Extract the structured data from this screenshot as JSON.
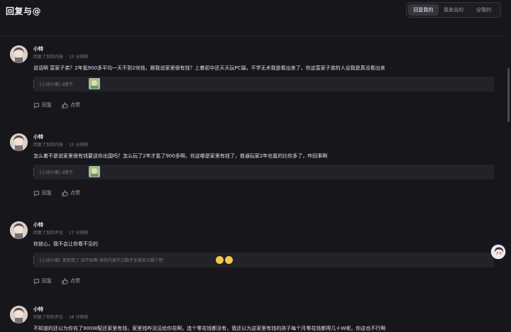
{
  "page": {
    "title": "回复与@"
  },
  "tabs": [
    {
      "label": "回复我的",
      "active": true
    },
    {
      "label": "我发出的",
      "active": false
    },
    {
      "label": "@我的",
      "active": false
    }
  ],
  "actions": {
    "reply_label": "回复",
    "like_label": "点赞"
  },
  "items": [
    {
      "username": "小特",
      "meta_action": "回复了你的内容",
      "time": "13 分钟前",
      "text": "说话啊 富家子弟？2年氪900多平均一天不到2块钱，跟我说家里很有钱？上着初中还天天玩PC端，不学无术我是看出来了，你这富家子弟的人设我是真没看出来",
      "quote_tag": "[心动小镇]",
      "quote_text": "d搓子",
      "quote_extras": "sticker"
    },
    {
      "username": "小特",
      "meta_action": "回复了你的内容",
      "time": "15 分钟前",
      "text": "怎么着不是说家里很有钱要送你出国吗？怎么玩了2年才氪了900多啊，你这哪是家里有钱了，普通玩家2年也氪的比你多了，咋回事啊",
      "quote_tag": "[心动小镇]",
      "quote_text": "d搓子",
      "quote_extras": "sticker"
    },
    {
      "username": "小特",
      "meta_action": "回复了你的评论",
      "time": "17 分钟前",
      "text": "你放心，我不会让你看不见的",
      "quote_tag": "[心动小镇]",
      "quote_text": "笑死我了 招不招啊 发的内容不过脑子全被官方删了吧",
      "quote_extras": "emoji"
    },
    {
      "username": "小特",
      "meta_action": "回复了你的评论",
      "time": "18 分钟前",
      "text": "不知道的还以为你充了900W配还家里有钱，家里钱咋没见给你花啊，连个零花钱都没有，我还以为这家里有钱的孩子每个月零花钱都得几十W呢，你这也不行啊"
    }
  ]
}
